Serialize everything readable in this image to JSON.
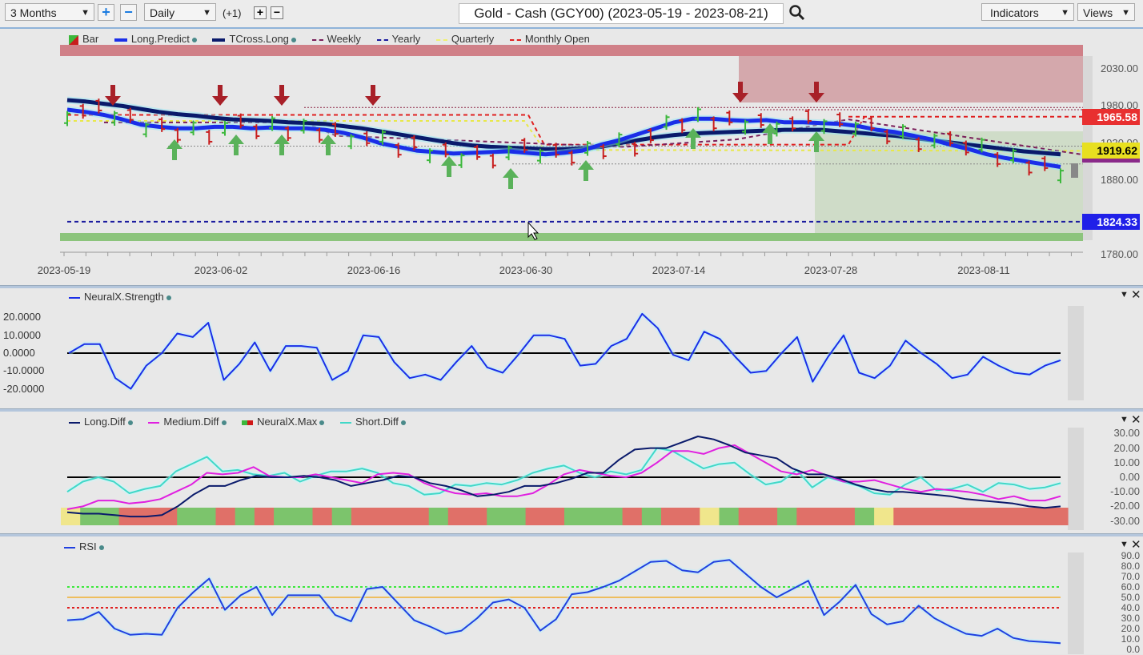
{
  "toolbar": {
    "period": "3 Months",
    "interval": "Daily",
    "offset": "(+1)",
    "title": "Gold - Cash (GCY00) (2023-05-19 - 2023-08-21)",
    "indicators": "Indicators",
    "views": "Views",
    "icons": {
      "zoom_in": "plus-icon",
      "zoom_out": "minus-icon",
      "search": "search-icon",
      "dropdown": "chevron-down-icon"
    }
  },
  "colors": {
    "bull": "#3cb83c",
    "bear": "#c81e1e",
    "long_predict": "#1a2ee8",
    "tcross_long": "#0a1a6b",
    "weekly": "#7a1f5a",
    "yearly": "#1a1a9e",
    "quarterly": "#e8e84a",
    "monthly_open": "#e02020",
    "medium_diff": "#e020e0",
    "short_diff": "#40d8c8",
    "rsi": "#2040e0",
    "max_green": "#7cc46c",
    "max_red": "#e07068",
    "max_yellow": "#f0e68c"
  },
  "chart_data": [
    {
      "type": "line",
      "title": "Gold - Cash (GCY00) (2023-05-19 - 2023-08-21)",
      "panel": "price",
      "x_ticks": [
        "2023-05-19",
        "2023-06-02",
        "2023-06-16",
        "2023-06-30",
        "2023-07-14",
        "2023-07-28",
        "2023-08-11"
      ],
      "y_ticks": [
        2030.0,
        1980.0,
        1930.0,
        1880.0,
        1780.0
      ],
      "ylim": [
        1770,
        2050
      ],
      "legend": [
        "Bar",
        "Long.Predict",
        "TCross.Long",
        "Weekly",
        "Yearly",
        "Quarterly",
        "Monthly Open"
      ],
      "price_tags": [
        {
          "value": "1965.58",
          "color": "#e83030",
          "text_color": "#ffffff"
        },
        {
          "value": "1919.62",
          "color": "#e8e020",
          "text_color": "#000000"
        },
        {
          "value": "1824.33",
          "color": "#2020e8",
          "text_color": "#ffffff"
        }
      ],
      "series": [
        {
          "name": "Long.Predict",
          "values": [
            1975,
            1972,
            1968,
            1962,
            1955,
            1952,
            1950,
            1950,
            1952,
            1952,
            1950,
            1951,
            1950,
            1950,
            1948,
            1944,
            1938,
            1930,
            1925,
            1920,
            1918,
            1916,
            1917,
            1918,
            1919,
            1917,
            1915,
            1917,
            1920,
            1928,
            1934,
            1942,
            1950,
            1958,
            1963,
            1963,
            1961,
            1960,
            1961,
            1958,
            1958,
            1957,
            1956,
            1953,
            1948,
            1945,
            1940,
            1935,
            1928,
            1922,
            1915,
            1910,
            1906,
            1902,
            1898
          ]
        },
        {
          "name": "TCross.Long",
          "values": [
            1988,
            1986,
            1983,
            1980,
            1976,
            1972,
            1969,
            1967,
            1964,
            1962,
            1961,
            1960,
            1958,
            1957,
            1956,
            1953,
            1950,
            1946,
            1942,
            1938,
            1934,
            1930,
            1927,
            1925,
            1924,
            1923,
            1922,
            1922,
            1923,
            1925,
            1930,
            1934,
            1938,
            1941,
            1943,
            1944,
            1945,
            1946,
            1947,
            1948,
            1948,
            1948,
            1946,
            1944,
            1942,
            1940,
            1937,
            1934,
            1931,
            1928,
            1925,
            1922,
            1919,
            1917,
            1915
          ]
        }
      ],
      "levels": [
        {
          "name": "Monthly Open",
          "value": 1965.58
        },
        {
          "name": "Quarterly",
          "value": 1919.62
        },
        {
          "name": "Yearly",
          "value": 1824.33
        }
      ],
      "signals": {
        "down_arrows": [
          3,
          9,
          13,
          19,
          38,
          43
        ],
        "up_arrows": [
          6,
          10,
          13,
          16,
          22,
          27,
          32,
          38,
          43
        ]
      }
    },
    {
      "type": "line",
      "panel": "NeuralX.Strength",
      "legend": [
        "NeuralX.Strength"
      ],
      "y_ticks": [
        "20.0000",
        "10.0000",
        "0.0000",
        "-10.0000",
        "-20.0000"
      ],
      "ylim": [
        -25,
        28
      ],
      "series": [
        {
          "name": "NeuralX.Strength",
          "values": [
            0,
            5,
            5,
            -14,
            -20,
            -7,
            0,
            11,
            9,
            17,
            -15,
            -6,
            6,
            -10,
            4,
            4,
            3,
            -15,
            -10,
            10,
            9,
            -5,
            -14,
            -12,
            -15,
            -5,
            4,
            -8,
            -11,
            -1,
            10,
            10,
            8,
            -7,
            -6,
            4,
            8,
            22,
            14,
            -1,
            -4,
            12,
            8,
            -2,
            -11,
            -10,
            0,
            9,
            -16,
            -2,
            10,
            -11,
            -14,
            -7,
            7,
            0,
            -6,
            -14,
            -12,
            -2,
            -7,
            -11,
            -12,
            -7,
            -4
          ]
        }
      ]
    },
    {
      "type": "line",
      "panel": "Diff",
      "legend": [
        "Long.Diff",
        "Medium.Diff",
        "NeuralX.Max",
        "Short.Diff"
      ],
      "y_ticks": [
        "30.00",
        "20.00",
        "10.00",
        "0.00",
        "-10.00",
        "-20.00",
        "-30.00"
      ],
      "ylim": [
        -34,
        34
      ],
      "series": [
        {
          "name": "Long.Diff",
          "values": [
            -24,
            -25,
            -25,
            -26,
            -27,
            -27,
            -26,
            -20,
            -12,
            -6,
            -6,
            -2,
            1,
            0,
            0,
            1,
            0,
            -2,
            -6,
            -4,
            -2,
            1,
            0,
            -4,
            -6,
            -9,
            -13,
            -12,
            -10,
            -6,
            -6,
            -4,
            -1,
            3,
            3,
            12,
            19,
            20,
            20,
            24,
            28,
            26,
            22,
            17,
            15,
            13,
            6,
            2,
            2,
            -1,
            -5,
            -8,
            -10,
            -10,
            -11,
            -12,
            -13,
            -15,
            -16,
            -17,
            -18,
            -20,
            -21,
            -20
          ]
        },
        {
          "name": "Medium.Diff",
          "values": [
            -22,
            -20,
            -16,
            -16,
            -18,
            -17,
            -15,
            -10,
            -5,
            3,
            2,
            3,
            7,
            1,
            0,
            0,
            2,
            0,
            -2,
            -4,
            2,
            3,
            2,
            -4,
            -8,
            -11,
            -12,
            -11,
            -13,
            -13,
            -11,
            -5,
            2,
            5,
            3,
            1,
            0,
            3,
            10,
            18,
            18,
            16,
            20,
            22,
            16,
            10,
            4,
            2,
            5,
            1,
            -3,
            -3,
            -2,
            -5,
            -8,
            -10,
            -8,
            -9,
            -10,
            -12,
            -15,
            -13,
            -16,
            -16,
            -13
          ]
        },
        {
          "name": "Short.Diff",
          "values": [
            -10,
            -3,
            0,
            -3,
            -11,
            -8,
            -6,
            4,
            9,
            14,
            4,
            5,
            2,
            1,
            3,
            -3,
            1,
            4,
            4,
            6,
            3,
            -4,
            -6,
            -12,
            -11,
            -5,
            -6,
            -4,
            -5,
            -2,
            3,
            6,
            8,
            3,
            0,
            4,
            2,
            5,
            20,
            18,
            12,
            6,
            9,
            10,
            2,
            -5,
            -3,
            5,
            -7,
            0,
            -3,
            -6,
            -11,
            -12,
            -5,
            0,
            -9,
            -8,
            -5,
            -10,
            -4,
            -5,
            -8,
            -7,
            -4
          ]
        }
      ],
      "neuralx_max": [
        "yellow",
        "green",
        "green",
        "red",
        "red",
        "red",
        "green",
        "green",
        "red",
        "green",
        "red",
        "green",
        "green",
        "red",
        "green",
        "red",
        "red",
        "red",
        "red",
        "green",
        "red",
        "red",
        "green",
        "green",
        "red",
        "red",
        "green",
        "green",
        "green",
        "red",
        "green",
        "red",
        "red",
        "yellow",
        "green",
        "red",
        "red",
        "green",
        "red",
        "red",
        "red",
        "green",
        "yellow",
        "red",
        "red",
        "red",
        "red",
        "red",
        "red",
        "red",
        "red",
        "red"
      ]
    },
    {
      "type": "line",
      "panel": "RSI",
      "legend": [
        "RSI"
      ],
      "y_ticks": [
        "90.0",
        "80.0",
        "70.0",
        "60.0",
        "50.0",
        "40.0",
        "30.0",
        "20.0",
        "10.0",
        "0.0"
      ],
      "ylim": [
        0,
        95
      ],
      "levels": [
        {
          "name": "overbought",
          "value": 60
        },
        {
          "name": "mid",
          "value": 50
        },
        {
          "name": "oversold",
          "value": 40
        }
      ],
      "series": [
        {
          "name": "RSI",
          "values": [
            28,
            29,
            36,
            20,
            14,
            15,
            14,
            40,
            55,
            68,
            38,
            52,
            60,
            33,
            52,
            52,
            52,
            33,
            27,
            58,
            60,
            44,
            28,
            22,
            15,
            18,
            30,
            45,
            48,
            40,
            18,
            29,
            53,
            55,
            60,
            66,
            75,
            84,
            85,
            76,
            74,
            84,
            86,
            73,
            60,
            50,
            58,
            66,
            33,
            46,
            62,
            34,
            24,
            27,
            42,
            30,
            22,
            15,
            13,
            20,
            11,
            8,
            7,
            6
          ]
        }
      ]
    }
  ]
}
